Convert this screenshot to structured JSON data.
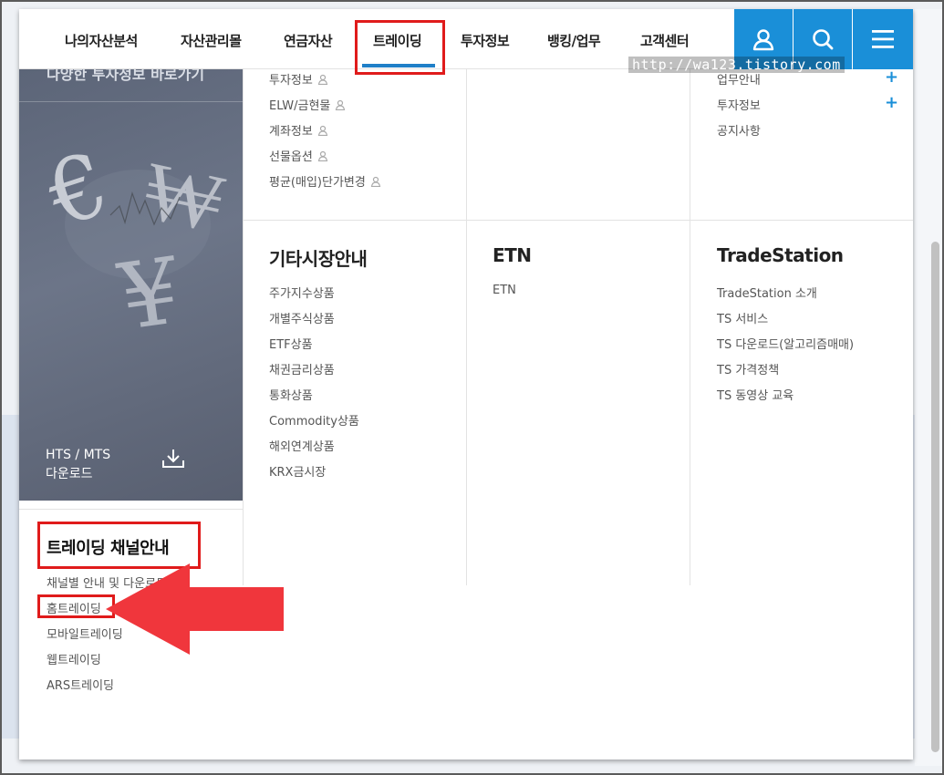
{
  "nav": {
    "items": [
      "나의자산분석",
      "자산관리몰",
      "연금자산",
      "트레이딩",
      "투자정보",
      "뱅킹/업무",
      "고객센터"
    ],
    "active_index": 3,
    "icons": [
      "user-icon",
      "search-icon",
      "menu-icon"
    ],
    "accent_color": "#1a8fd8"
  },
  "watermark": "http://wa123.tistory.com",
  "hero": {
    "title": "다양한 투자정보 바로가기",
    "hts_line1": "HTS / MTS",
    "hts_line2": "다운로드"
  },
  "upper_col1": {
    "items": [
      "투자정보",
      "ELW/금현물",
      "계좌정보",
      "선물옵션",
      "평균(매입)단가변경"
    ]
  },
  "upper_col3": {
    "items": [
      "업무안내",
      "투자정보",
      "공지사항"
    ]
  },
  "col_other_markets": {
    "title": "기타시장안내",
    "items": [
      "주가지수상품",
      "개별주식상품",
      "ETF상품",
      "채권금리상품",
      "통화상품",
      "Commodity상품",
      "해외연계상품",
      "KRX금시장"
    ]
  },
  "col_etn": {
    "title": "ETN",
    "items": [
      "ETN"
    ]
  },
  "col_tradestation": {
    "title": "TradeStation",
    "items": [
      "TradeStation 소개",
      "TS 서비스",
      "TS 다운로드(알고리즘매매)",
      "TS 가격정책",
      "TS 동영상 교육"
    ]
  },
  "channel": {
    "title": "트레이딩 채널안내",
    "items": [
      "채널별 안내 및 다운로드",
      "홈트레이딩",
      "모바일트레이딩",
      "웹트레이딩",
      "ARS트레이딩"
    ]
  },
  "colors": {
    "highlight": "#e01b1b",
    "arrow": "#f0363c"
  }
}
